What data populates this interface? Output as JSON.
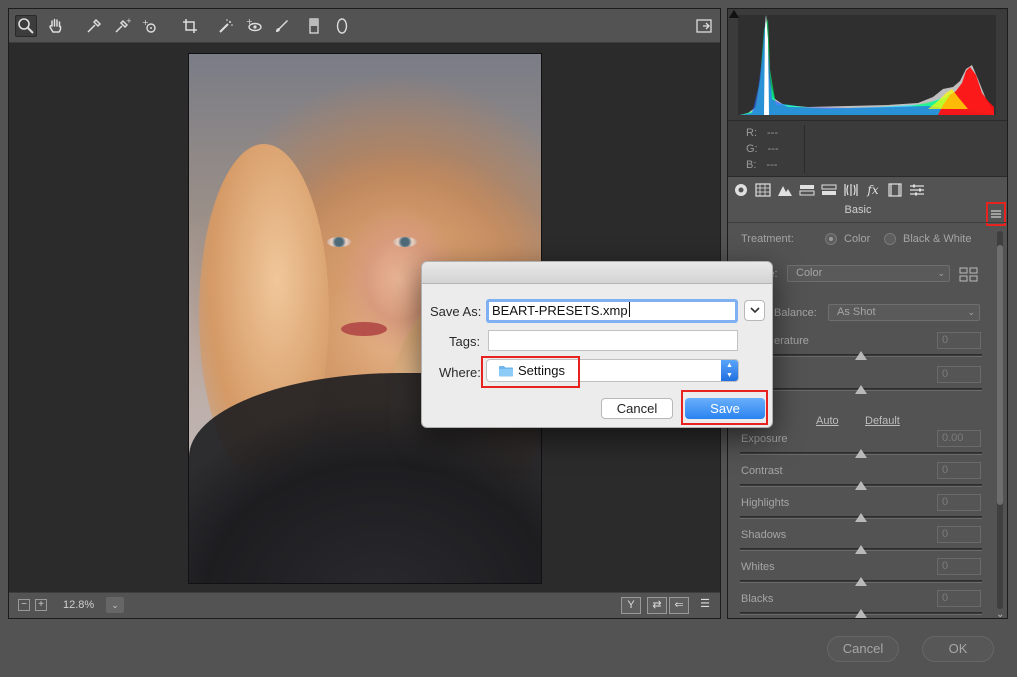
{
  "toolbar": {
    "tools": [
      "zoom-icon",
      "hand-icon",
      "white-balance-icon",
      "color-sampler-icon",
      "targeted-adjustment-icon",
      "crop-icon",
      "spot-removal-icon",
      "red-eye-icon",
      "adjustment-brush-icon",
      "graduated-filter-icon",
      "radial-filter-icon",
      "fullscreen-icon"
    ]
  },
  "statusbar": {
    "zoom_out": "−",
    "zoom_in": "+",
    "zoom_value": "12.8%",
    "zoom_dropdown": "⌄",
    "compare": "Y",
    "swap": "⇄",
    "copy": "⇐",
    "prefs": "☰"
  },
  "histogram": {
    "r_label": "R:",
    "g_label": "G:",
    "b_label": "B:",
    "r_value": "---",
    "g_value": "---",
    "b_value": "---"
  },
  "panel": {
    "title": "Basic",
    "treatment_label": "Treatment:",
    "treatment_color": "Color",
    "treatment_bw": "Black & White",
    "profile_label": "le:",
    "profile_value": "Color",
    "wb_label": "Balance:",
    "wb_value": "As Shot",
    "temperature_label": "erature",
    "temperature_value": "0",
    "tint_value": "0",
    "auto_link": "Auto",
    "default_link": "Default",
    "sliders": [
      {
        "label": "Exposure",
        "value": "0.00"
      },
      {
        "label": "Contrast",
        "value": "0"
      },
      {
        "label": "Highlights",
        "value": "0"
      },
      {
        "label": "Shadows",
        "value": "0"
      },
      {
        "label": "Whites",
        "value": "0"
      },
      {
        "label": "Blacks",
        "value": "0"
      }
    ]
  },
  "bottom": {
    "cancel": "Cancel",
    "ok": "OK"
  },
  "dialog": {
    "save_as_label": "Save As:",
    "save_as_value": "BEART-PRESETS.xmp",
    "tags_label": "Tags:",
    "tags_value": "",
    "where_label": "Where:",
    "where_value": "Settings",
    "cancel_label": "Cancel",
    "save_label": "Save"
  },
  "colors": {
    "highlight_red": "#e8231f",
    "save_blue": "#2a82f0",
    "panel_bg": "#535353"
  }
}
